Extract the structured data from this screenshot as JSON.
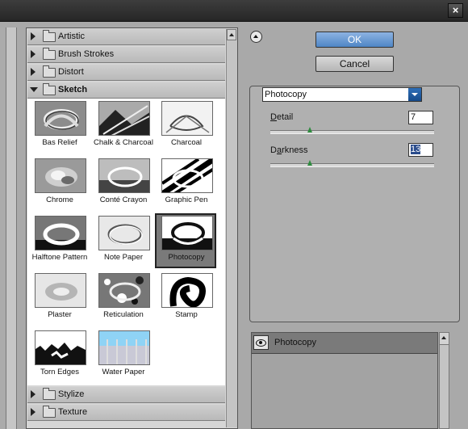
{
  "window": {
    "close_label": "×"
  },
  "gallery": {
    "categories_top": [
      "Artistic",
      "Brush Strokes",
      "Distort"
    ],
    "open_category": "Sketch",
    "filters": [
      {
        "name": "Bas Relief",
        "icon": "bas-relief-thumbnail"
      },
      {
        "name": "Chalk & Charcoal",
        "icon": "chalk-charcoal-thumbnail"
      },
      {
        "name": "Charcoal",
        "icon": "charcoal-thumbnail"
      },
      {
        "name": "Chrome",
        "icon": "chrome-thumbnail"
      },
      {
        "name": "Conté Crayon",
        "icon": "conte-crayon-thumbnail"
      },
      {
        "name": "Graphic Pen",
        "icon": "graphic-pen-thumbnail"
      },
      {
        "name": "Halftone Pattern",
        "icon": "halftone-pattern-thumbnail"
      },
      {
        "name": "Note Paper",
        "icon": "note-paper-thumbnail"
      },
      {
        "name": "Photocopy",
        "icon": "photocopy-thumbnail",
        "selected": true
      },
      {
        "name": "Plaster",
        "icon": "plaster-thumbnail"
      },
      {
        "name": "Reticulation",
        "icon": "reticulation-thumbnail"
      },
      {
        "name": "Stamp",
        "icon": "stamp-thumbnail"
      },
      {
        "name": "Torn Edges",
        "icon": "torn-edges-thumbnail"
      },
      {
        "name": "Water Paper",
        "icon": "water-paper-thumbnail"
      }
    ],
    "categories_bottom": [
      "Stylize",
      "Texture"
    ]
  },
  "buttons": {
    "ok": "OK",
    "cancel": "Cancel"
  },
  "settings": {
    "filter_select": "Photocopy",
    "detail": {
      "label_first": "D",
      "label_rest": "etail",
      "value": "7",
      "level": 0.24
    },
    "darkness": {
      "label_first": "D",
      "label_mid": "a",
      "label_rest": "rkness",
      "value": "13",
      "level": 0.24
    }
  },
  "layers": {
    "items": [
      {
        "name": "Photocopy",
        "visible": true
      }
    ]
  },
  "colors": {
    "ok_button": "#4f86c6",
    "selected_thumb_bg": "#7a7a7a",
    "slider_knob": "#2e8b3e"
  }
}
